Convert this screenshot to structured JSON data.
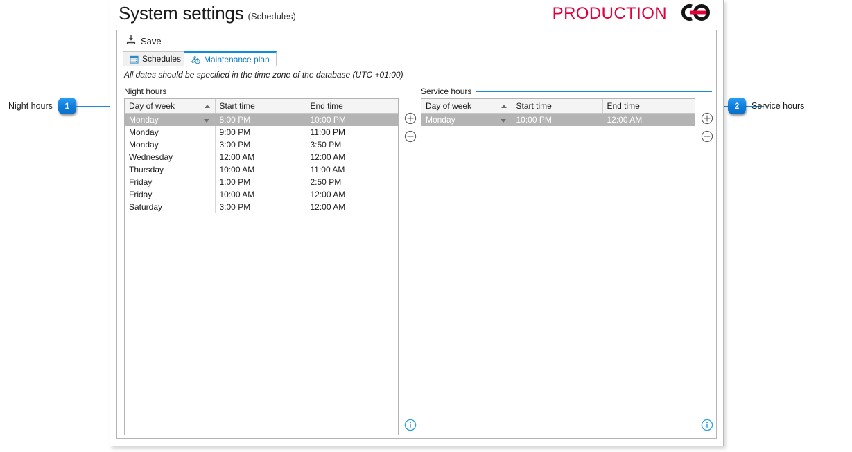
{
  "window": {
    "title": "System settings",
    "subtitle": "(Schedules)",
    "logo_text": "PRODUCTION",
    "logo_icon": "chain-link-logo",
    "accent_color": "#e2003c",
    "ui_accent_color": "#1e8ad6"
  },
  "toolbar": {
    "save_label": "Save",
    "save_icon": "save-icon"
  },
  "tabs": [
    {
      "label": "Schedules",
      "icon": "calendar-icon",
      "active": false
    },
    {
      "label": "Maintenance plan",
      "icon": "wrench-clock-icon",
      "active": true
    }
  ],
  "note": "All dates should be specified in the time zone of the database (UTC +01:00)",
  "panels": [
    {
      "group_label": "Night hours",
      "has_rule": false,
      "columns": [
        "Day of week",
        "Start time",
        "End time"
      ],
      "sorted_column": "Day of week",
      "sort_direction": "ascending",
      "rows": [
        {
          "day": "Monday",
          "start": "8:00 PM",
          "end": "10:00 PM",
          "selected": true
        },
        {
          "day": "Monday",
          "start": "9:00 PM",
          "end": "11:00 PM",
          "selected": false
        },
        {
          "day": "Monday",
          "start": "3:00 PM",
          "end": "3:50 PM",
          "selected": false
        },
        {
          "day": "Wednesday",
          "start": "12:00 AM",
          "end": "12:00 AM",
          "selected": false
        },
        {
          "day": "Thursday",
          "start": "10:00 AM",
          "end": "11:00 AM",
          "selected": false
        },
        {
          "day": "Friday",
          "start": "1:00 PM",
          "end": "2:50 PM",
          "selected": false
        },
        {
          "day": "Friday",
          "start": "10:00 AM",
          "end": "12:00 AM",
          "selected": false
        },
        {
          "day": "Saturday",
          "start": "3:00 PM",
          "end": "12:00 AM",
          "selected": false
        }
      ],
      "add_icon": "plus-circle-icon",
      "remove_icon": "minus-circle-icon",
      "info_icon": "info-circle-icon"
    },
    {
      "group_label": "Service hours",
      "has_rule": true,
      "columns": [
        "Day of week",
        "Start time",
        "End time"
      ],
      "sorted_column": "Day of week",
      "sort_direction": "ascending",
      "rows": [
        {
          "day": "Monday",
          "start": "10:00 PM",
          "end": "12:00 AM",
          "selected": true
        }
      ],
      "add_icon": "plus-circle-icon",
      "remove_icon": "minus-circle-icon",
      "info_icon": "info-circle-icon"
    }
  ],
  "callouts": [
    {
      "number": "1",
      "label": "Night hours",
      "position": "left"
    },
    {
      "number": "2",
      "label": "Service hours",
      "position": "right"
    }
  ]
}
